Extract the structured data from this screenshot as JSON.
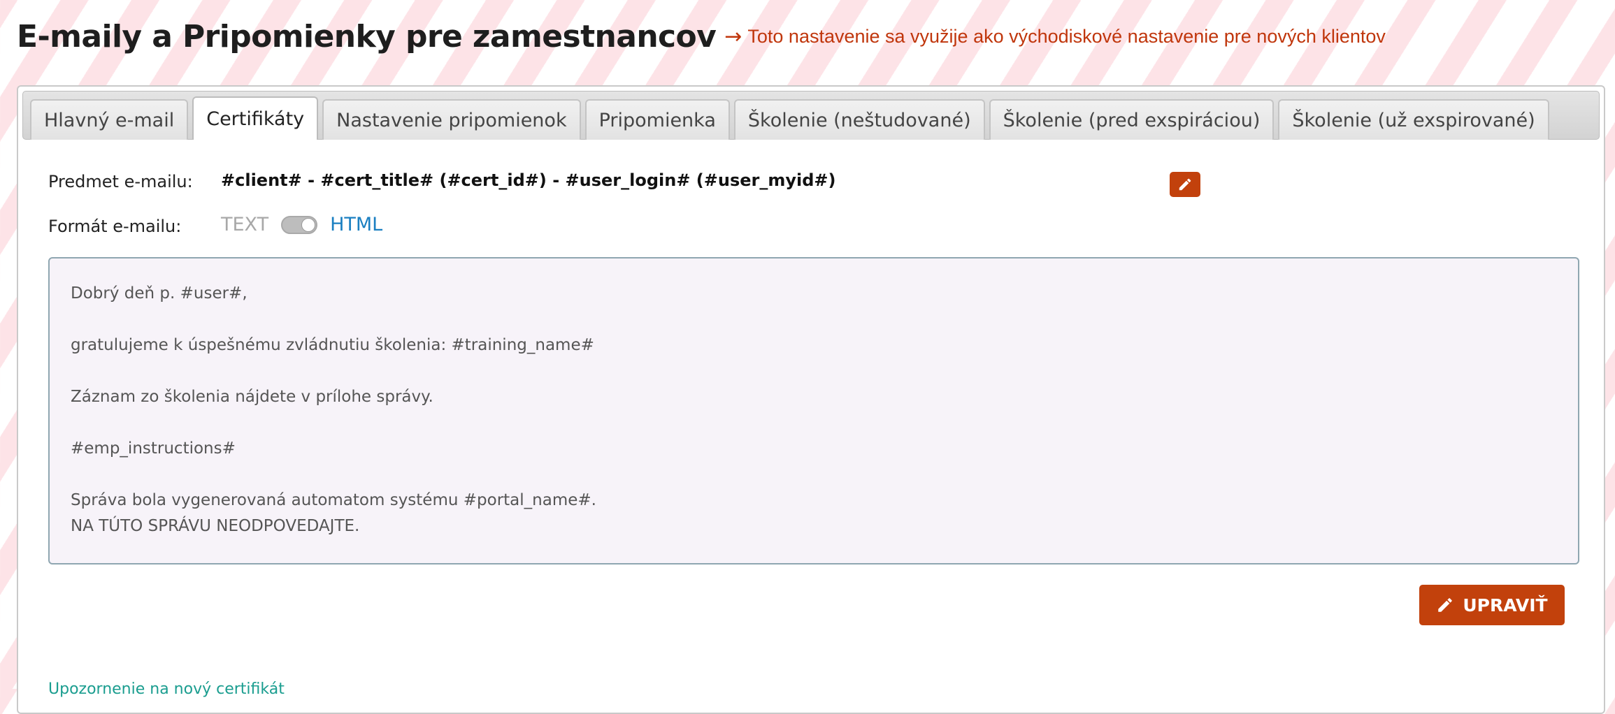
{
  "header": {
    "title": "E-maily a Pripomienky pre zamestnancov",
    "arrow": "→",
    "subtitle": "Toto nastavenie sa využije ako východiskové nastavenie pre nových klientov"
  },
  "tabs": [
    {
      "label": "Hlavný e-mail",
      "active": false
    },
    {
      "label": "Certifikáty",
      "active": true
    },
    {
      "label": "Nastavenie pripomienok",
      "active": false
    },
    {
      "label": "Pripomienka",
      "active": false
    },
    {
      "label": "Školenie (neštudované)",
      "active": false
    },
    {
      "label": "Školenie (pred exspiráciou)",
      "active": false
    },
    {
      "label": "Školenie (už exspirované)",
      "active": false
    }
  ],
  "subject": {
    "label": "Predmet e-mailu:",
    "value": "#client# - #cert_title# (#cert_id#) - #user_login# (#user_myid#)",
    "edit_icon": "pencil-icon"
  },
  "format": {
    "label": "Formát e-mailu:",
    "option_text": "TEXT",
    "option_html": "HTML",
    "selected": "HTML"
  },
  "email_body": {
    "greeting": "Dobrý deň p. #user#,",
    "congrats": "gratulujeme k úspešnému zvládnutiu školenia: #training_name#",
    "attachment": "Záznam zo školenia nájdete v prílohe správy.",
    "instructions": "#emp_instructions#",
    "generated": "Správa bola vygenerovaná automatom systému #portal_name#.",
    "noreply": "NA TÚTO SPRÁVU NEODPOVEDAJTE."
  },
  "actions": {
    "edit_label": "UPRAVIŤ"
  },
  "partial_link": "Upozornenie na nový certifikát"
}
